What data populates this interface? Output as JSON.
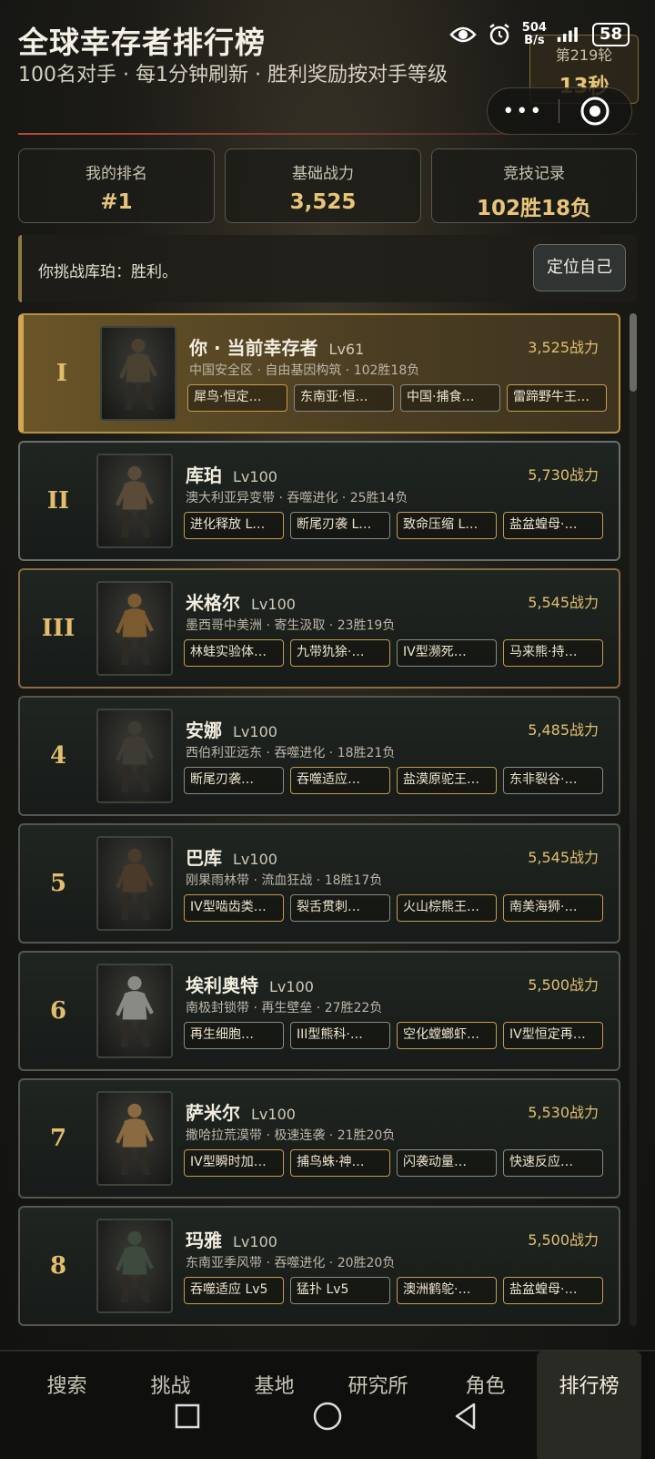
{
  "status": {
    "net_speed_value": "504",
    "net_speed_unit": "B/s",
    "battery": "58",
    "eye_icon": "eye-icon",
    "alarm_icon": "alarm-icon",
    "signal_icon": "signal-icon"
  },
  "header": {
    "title": "全球幸存者排行榜",
    "subtitle": "100名对手 · 每1分钟刷新 · 胜利奖励按对手等级",
    "round_label": "第219轮",
    "round_time": "13秒",
    "capsule_more": "•••"
  },
  "stats": [
    {
      "label": "我的排名",
      "value": "#1"
    },
    {
      "label": "基础战力",
      "value": "3,525"
    },
    {
      "label": "竞技记录",
      "value": "102胜18负"
    }
  ],
  "message": {
    "text": "你挑战库珀：胜利。",
    "locate_button": "定位自己"
  },
  "players": [
    {
      "rank": "I",
      "name": "你 · 当前幸存者",
      "level": "Lv61",
      "power": "3,525战力",
      "meta": "中国安全区 · 自由基因构筑 · 102胜18负",
      "tags": [
        "犀鸟·恒定…",
        "东南亚·恒…",
        "中国·捕食…",
        "雷蹄野牛王…"
      ]
    },
    {
      "rank": "II",
      "name": "库珀",
      "level": "Lv100",
      "power": "5,730战力",
      "meta": "澳大利亚异变带 · 吞噬进化 · 25胜14负",
      "tags": [
        "进化释放 L…",
        "断尾刃袭 L…",
        "致命压缩 L…",
        "盐盆蝗母·…"
      ]
    },
    {
      "rank": "III",
      "name": "米格尔",
      "level": "Lv100",
      "power": "5,545战力",
      "meta": "墨西哥中美洲 · 寄生汲取 · 23胜19负",
      "tags": [
        "林蛙实验体…",
        "九带犰狳·…",
        "IV型濒死…",
        "马来熊·持…"
      ]
    },
    {
      "rank": "4",
      "name": "安娜",
      "level": "Lv100",
      "power": "5,485战力",
      "meta": "西伯利亚远东 · 吞噬进化 · 18胜21负",
      "tags": [
        "断尾刃袭…",
        "吞噬适应…",
        "盐漠原驼王…",
        "东非裂谷·…"
      ]
    },
    {
      "rank": "5",
      "name": "巴库",
      "level": "Lv100",
      "power": "5,545战力",
      "meta": "刚果雨林带 · 流血狂战 · 18胜17负",
      "tags": [
        "IV型啮齿类…",
        "裂舌贯刺…",
        "火山棕熊王…",
        "南美海狮·…"
      ]
    },
    {
      "rank": "6",
      "name": "埃利奥特",
      "level": "Lv100",
      "power": "5,500战力",
      "meta": "南极封锁带 · 再生壁垒 · 27胜22负",
      "tags": [
        "再生细胞…",
        "III型熊科·…",
        "空化螳螂虾…",
        "IV型恒定再…"
      ]
    },
    {
      "rank": "7",
      "name": "萨米尔",
      "level": "Lv100",
      "power": "5,530战力",
      "meta": "撒哈拉荒漠带 · 极速连袭 · 21胜20负",
      "tags": [
        "IV型瞬时加…",
        "捕鸟蛛·神…",
        "闪袭动量…",
        "快速反应…"
      ]
    },
    {
      "rank": "8",
      "name": "玛雅",
      "level": "Lv100",
      "power": "5,500战力",
      "meta": "东南亚季风带 · 吞噬进化 · 20胜20负",
      "tags": [
        "吞噬适应 Lv5",
        "猛扑 Lv5",
        "澳洲鹤鸵·…",
        "盐盆蝗母·…"
      ]
    }
  ],
  "nav": [
    "搜索",
    "挑战",
    "基地",
    "研究所",
    "角色",
    "排行榜"
  ],
  "nav_active": "排行榜",
  "colors": {
    "accent_gold": "#e2be6c",
    "first_bg": "#6b5528",
    "card_bg": "#1f2521"
  }
}
